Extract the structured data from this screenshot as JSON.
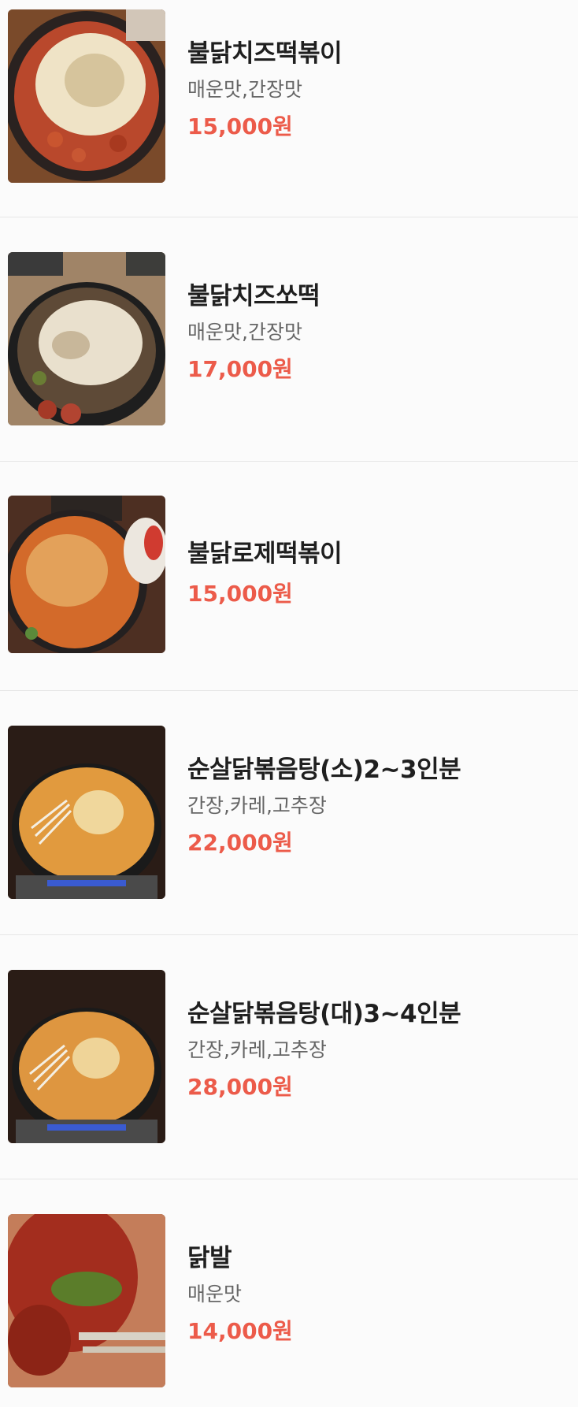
{
  "items": [
    {
      "name": "불닭치즈떡볶이",
      "description": "매운맛,간장맛",
      "price": "15,000원",
      "image": "cheese-tteokbokki-photo"
    },
    {
      "name": "불닭치즈쏘떡",
      "description": "매운맛,간장맛",
      "price": "17,000원",
      "image": "cheese-sotteok-photo"
    },
    {
      "name": "불닭로제떡볶이",
      "description": "",
      "price": "15,000원",
      "image": "rose-tteokbokki-photo"
    },
    {
      "name": "순살닭볶음탕(소)2~3인분",
      "description": "간장,카레,고추장",
      "price": "22,000원",
      "image": "chicken-stew-small-photo"
    },
    {
      "name": "순살닭볶음탕(대)3~4인분",
      "description": "간장,카레,고추장",
      "price": "28,000원",
      "image": "chicken-stew-large-photo"
    },
    {
      "name": "닭발",
      "description": "매운맛",
      "price": "14,000원",
      "image": "chicken-feet-photo"
    }
  ],
  "colors": {
    "price": "#ec5b4a",
    "name": "#1f1f1f",
    "description": "#666666",
    "divider": "#e6e6e6"
  }
}
